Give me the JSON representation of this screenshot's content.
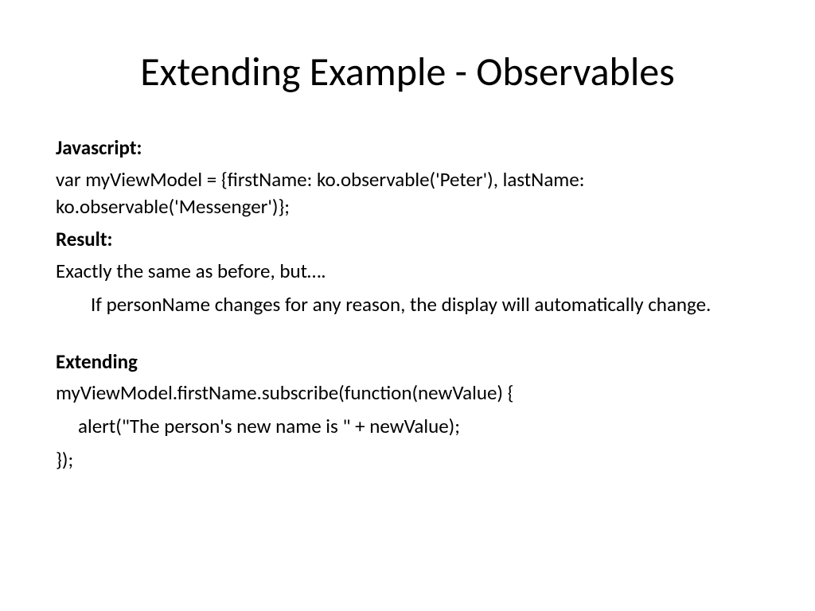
{
  "slide": {
    "title": "Extending Example - Observables",
    "sections": {
      "javascript": {
        "label": "Javascript:",
        "code": "var myViewModel = {firstName: ko.observable('Peter'), lastName: ko.observable('Messenger')};"
      },
      "result": {
        "label": "Result:",
        "line1": "Exactly the same as before, but….",
        "line2": "If personName changes for any reason, the display will automatically change."
      },
      "extending": {
        "label": "Extending",
        "code1": "myViewModel.firstName.subscribe(function(newValue) {",
        "code2": "alert(\"The person's new name is \" + newValue);",
        "code3": "});"
      }
    }
  }
}
